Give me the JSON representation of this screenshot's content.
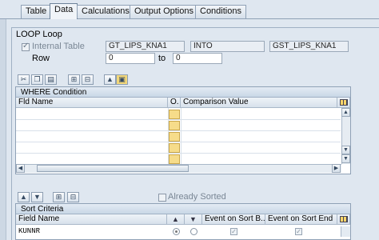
{
  "tabs": [
    {
      "label": "Table"
    },
    {
      "label": "Data"
    },
    {
      "label": "Calculations"
    },
    {
      "label": "Output Options"
    },
    {
      "label": "Conditions"
    }
  ],
  "loop": {
    "group_title": "LOOP Loop",
    "internal_table_label": "Internal Table",
    "internal_table_value": "GT_LIPS_KNA1",
    "mode_value": "INTO",
    "target_value": "GST_LIPS_KNA1",
    "row_label": "Row",
    "row_from": "0",
    "to_label": "to",
    "row_to": "0"
  },
  "where_table": {
    "title": "WHERE Condition",
    "columns": [
      "Fld Name",
      "O.",
      "Comparison Value"
    ]
  },
  "sort": {
    "already_sorted_label": "Already Sorted",
    "title": "Sort Criteria",
    "columns": [
      "Field Name",
      "Event on Sort B...",
      "Event on Sort End"
    ],
    "rows": [
      {
        "field": "KUNNR"
      }
    ]
  },
  "icons": {
    "toolbar1": [
      "cut-icon",
      "copy-icon",
      "paste-icon",
      "insert-row-icon",
      "delete-row-icon",
      "move-up-icon",
      "lock-icon"
    ],
    "toolbar2": [
      "arrow-up-icon",
      "arrow-down-icon",
      "insert-row-icon",
      "delete-row-icon"
    ]
  }
}
